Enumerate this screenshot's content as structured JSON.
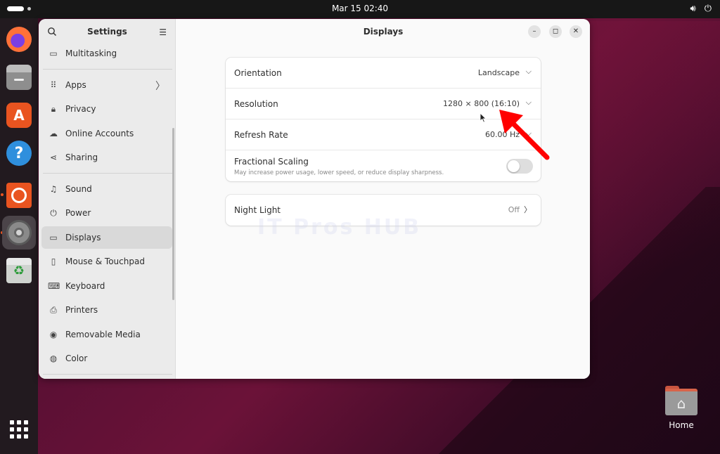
{
  "topbar": {
    "clock": "Mar 15  02:40"
  },
  "sidebar": {
    "title": "Settings",
    "items": [
      {
        "label": "Multitasking",
        "icon": "multitasking-icon"
      },
      {
        "label": "Apps",
        "icon": "apps-icon"
      },
      {
        "label": "Privacy",
        "icon": "lock-icon"
      },
      {
        "label": "Online Accounts",
        "icon": "cloud-icon"
      },
      {
        "label": "Sharing",
        "icon": "share-icon"
      },
      {
        "label": "Sound",
        "icon": "music-note-icon"
      },
      {
        "label": "Power",
        "icon": "power-icon"
      },
      {
        "label": "Displays",
        "icon": "monitor-icon",
        "selected": true
      },
      {
        "label": "Mouse & Touchpad",
        "icon": "mouse-icon"
      },
      {
        "label": "Keyboard",
        "icon": "keyboard-icon"
      },
      {
        "label": "Printers",
        "icon": "printer-icon"
      },
      {
        "label": "Removable Media",
        "icon": "removable-media-icon"
      },
      {
        "label": "Color",
        "icon": "color-icon"
      }
    ]
  },
  "content": {
    "title": "Displays",
    "settings": [
      {
        "label": "Orientation",
        "value": "Landscape"
      },
      {
        "label": "Resolution",
        "value": "1280 × 800 (16:10)"
      },
      {
        "label": "Refresh Rate",
        "value": "60.00 Hz"
      },
      {
        "label": "Fractional Scaling",
        "sublabel": "May increase power usage, lower speed, or reduce display sharpness.",
        "enabled": false
      }
    ],
    "night_light": {
      "label": "Night Light",
      "value": "Off"
    }
  },
  "watermark": "IT Pros HUB",
  "desktop": {
    "home_label": "Home"
  },
  "colors": {
    "accent": "#e95420",
    "annotation_arrow": "#ff0000"
  }
}
